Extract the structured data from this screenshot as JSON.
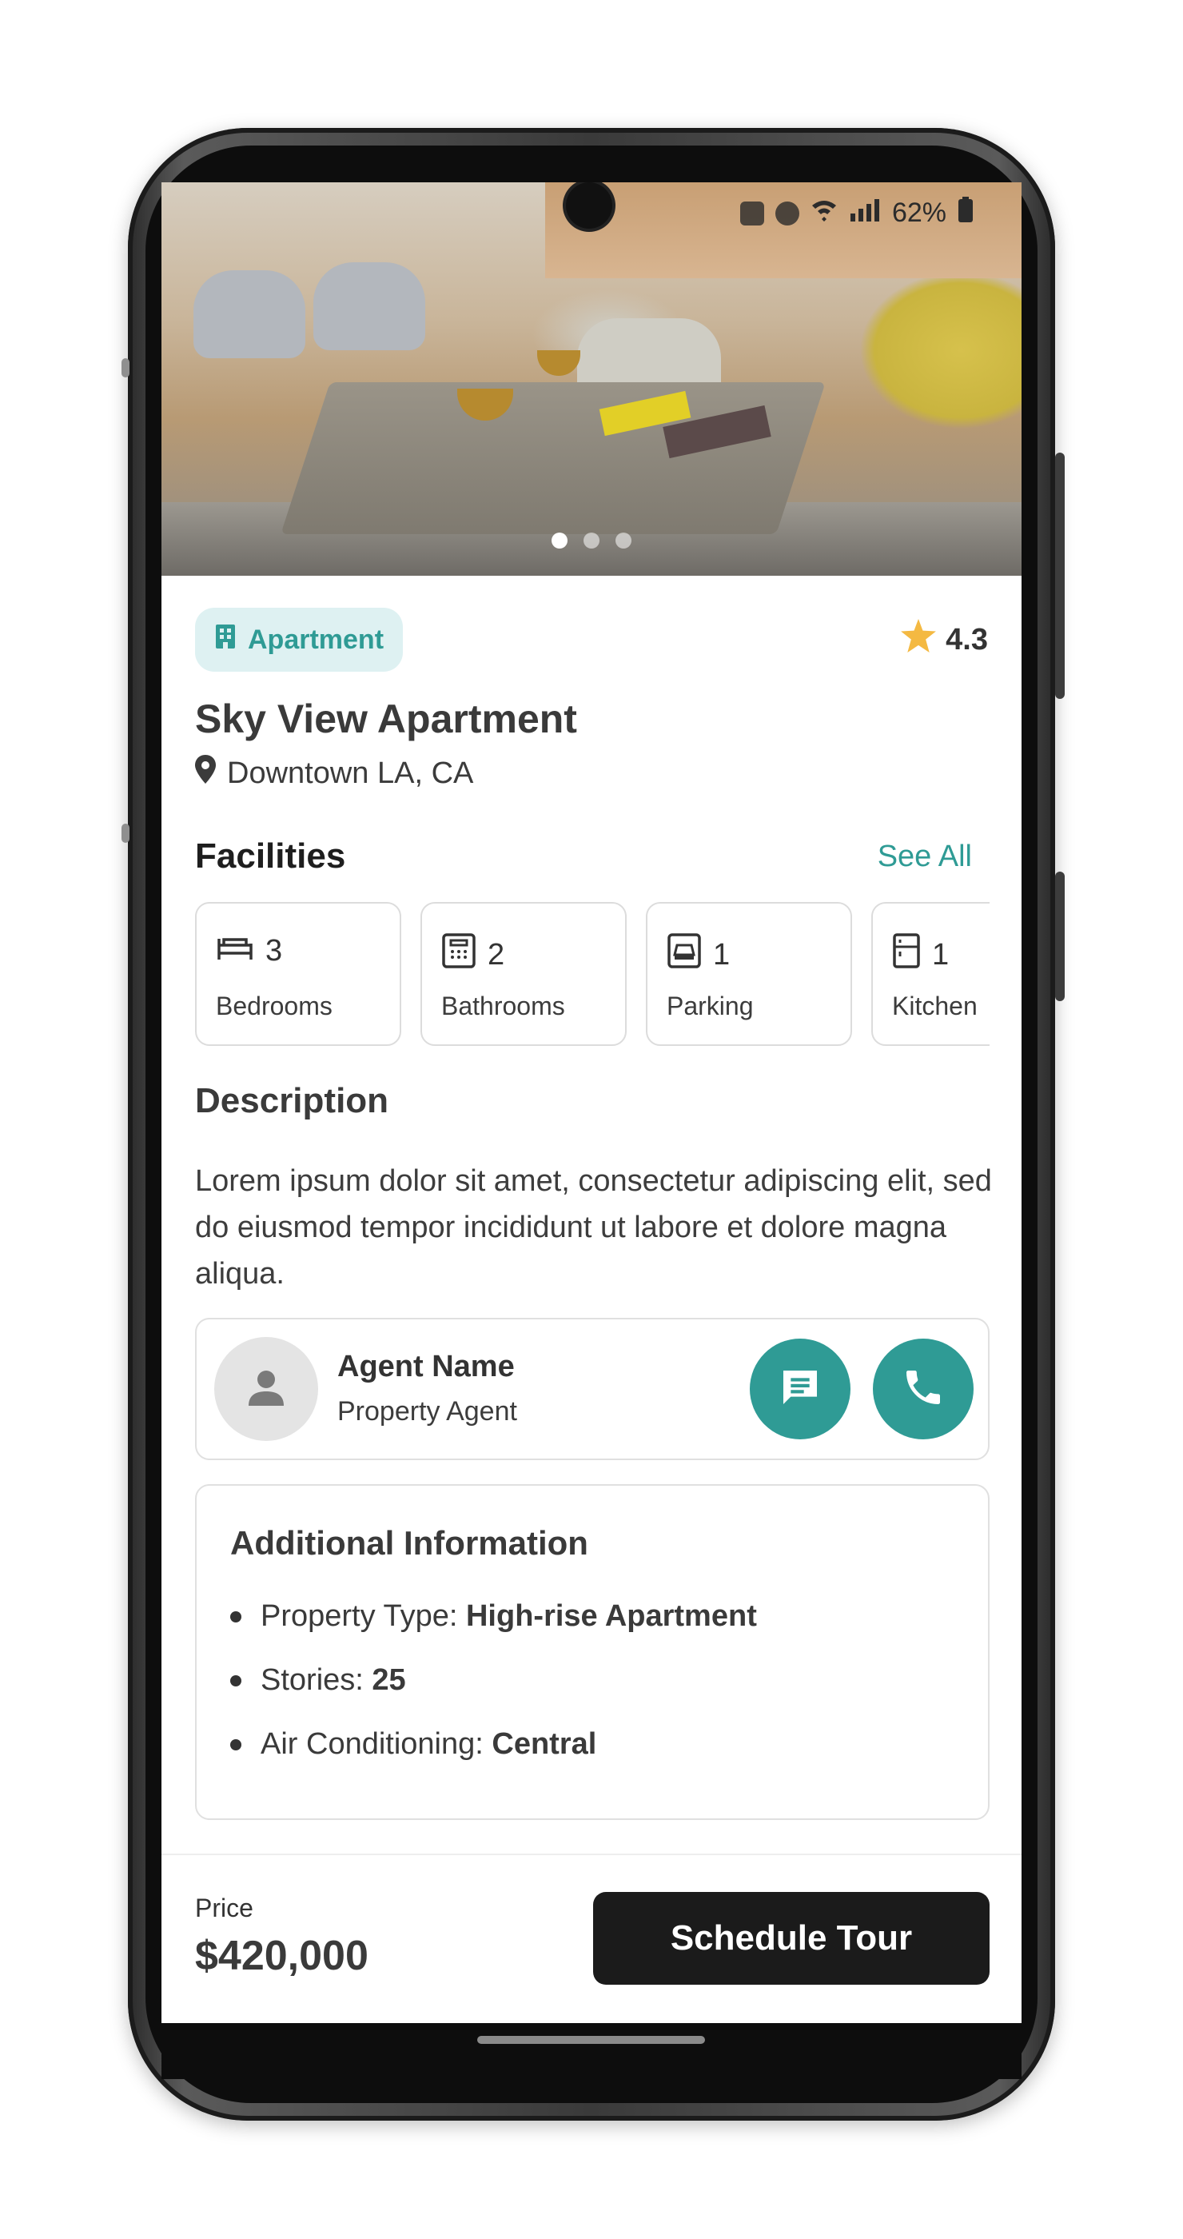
{
  "status_bar": {
    "battery": "62%"
  },
  "hero": {
    "carousel_pages": 3,
    "active_page": 1
  },
  "property": {
    "type_chip": "Apartment",
    "rating": "4.3",
    "name": "Sky View Apartment",
    "location": "Downtown LA, CA"
  },
  "facilities": {
    "title": "Facilities",
    "see_all": "See All",
    "items": [
      {
        "icon": "bed-icon",
        "count": "3",
        "label": "Bedrooms"
      },
      {
        "icon": "bathroom-icon",
        "count": "2",
        "label": "Bathrooms"
      },
      {
        "icon": "car-icon",
        "count": "1",
        "label": "Parking"
      },
      {
        "icon": "fridge-icon",
        "count": "1",
        "label": "Kitchen"
      }
    ]
  },
  "description": {
    "title": "Description",
    "text": "Lorem ipsum dolor sit amet, consectetur adipiscing elit, sed do eiusmod tempor incididunt ut labore et dolore magna aliqua."
  },
  "agent": {
    "name": "Agent Name",
    "role": "Property Agent"
  },
  "additional": {
    "title": "Additional Information",
    "items": [
      {
        "label": "Property Type: ",
        "value": "High-rise Apartment"
      },
      {
        "label": "Stories: ",
        "value": "25"
      },
      {
        "label": "Air Conditioning: ",
        "value": "Central"
      }
    ]
  },
  "footer": {
    "price_label": "Price",
    "price": "$420,000",
    "cta": "Schedule Tour"
  },
  "colors": {
    "accent": "#2f9b95",
    "chip_bg": "#def1f2",
    "star": "#f4b942",
    "cta_bg": "#1b1b1b"
  }
}
